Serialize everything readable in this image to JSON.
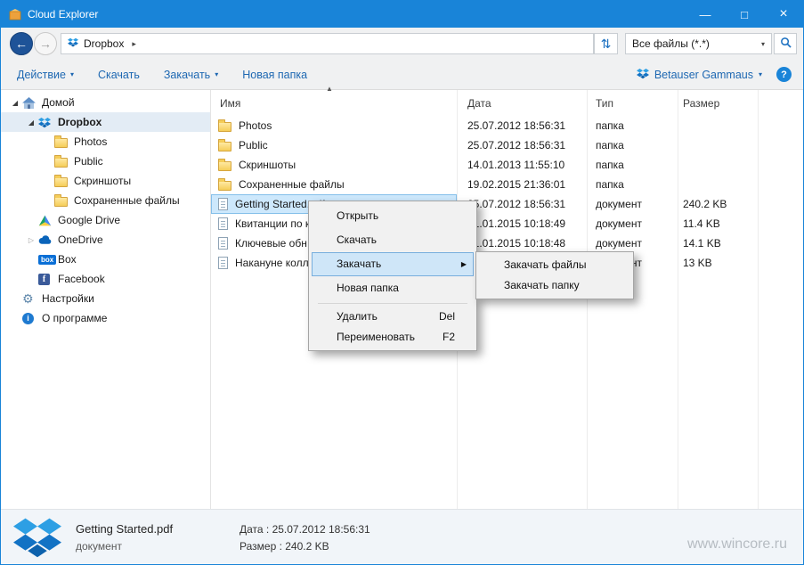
{
  "titlebar": {
    "title": "Cloud Explorer"
  },
  "glyphs": {
    "minimize": "—",
    "maximize": "□",
    "close": "×",
    "back": "←",
    "forward": "→",
    "refresh": "⇅",
    "caret_down": "▾",
    "breadcrumb_arrow": "▸",
    "expanded": "◢",
    "collapsed": "▷",
    "sort_asc": "▲",
    "submenu_arrow": "▶",
    "help": "?",
    "box_label": "box",
    "facebook_letter": "f",
    "info_letter": "i"
  },
  "nav": {
    "breadcrumb_item": "Dropbox",
    "filter_value": "Все файлы (*.*)"
  },
  "toolbar": {
    "action": "Действие",
    "download": "Скачать",
    "upload": "Закачать",
    "new_folder": "Новая папка",
    "account": "Betauser Gammaus"
  },
  "sidebar": {
    "items": [
      {
        "label": "Домой"
      },
      {
        "label": "Dropbox"
      },
      {
        "label": "Photos"
      },
      {
        "label": "Public"
      },
      {
        "label": "Скриншоты"
      },
      {
        "label": "Сохраненные файлы"
      },
      {
        "label": "Google Drive"
      },
      {
        "label": "OneDrive"
      },
      {
        "label": "Box"
      },
      {
        "label": "Facebook"
      },
      {
        "label": "Настройки"
      },
      {
        "label": "О программе"
      }
    ]
  },
  "filelist": {
    "columns": {
      "name": "Имя",
      "date": "Дата",
      "type": "Тип",
      "size": "Размер"
    },
    "rows": [
      {
        "name": "Photos",
        "date": "25.07.2012 18:56:31",
        "type": "папка",
        "size": ""
      },
      {
        "name": "Public",
        "date": "25.07.2012 18:56:31",
        "type": "папка",
        "size": ""
      },
      {
        "name": "Скриншоты",
        "date": "14.01.2013 11:55:10",
        "type": "папка",
        "size": ""
      },
      {
        "name": "Сохраненные файлы",
        "date": "19.02.2015 21:36:01",
        "type": "папка",
        "size": ""
      },
      {
        "name": "Getting Started.pdf",
        "date": "25.07.2012 18:56:31",
        "type": "документ",
        "size": "240.2 KB"
      },
      {
        "name": "Квитанции по к",
        "date": "21.01.2015 10:18:49",
        "type": "документ",
        "size": "11.4 KB"
      },
      {
        "name": "Ключевые обн",
        "date": "21.01.2015 10:18:48",
        "type": "документ",
        "size": "14.1 KB"
      },
      {
        "name": "Накануне колл",
        "date": "",
        "type": "документ",
        "size": "13 KB"
      }
    ]
  },
  "context_menu": {
    "open": "Открыть",
    "download": "Скачать",
    "upload": "Закачать",
    "new_folder": "Новая папка",
    "delete": "Удалить",
    "delete_shortcut": "Del",
    "rename": "Переименовать",
    "rename_shortcut": "F2",
    "submenu": {
      "upload_files": "Закачать файлы",
      "upload_folder": "Закачать папку"
    }
  },
  "statusbar": {
    "file_name": "Getting Started.pdf",
    "file_type": "документ",
    "date": "Дата : 25.07.2012 18:56:31",
    "size": "Размер : 240.2 KB",
    "watermark": "www.wincore.ru"
  }
}
